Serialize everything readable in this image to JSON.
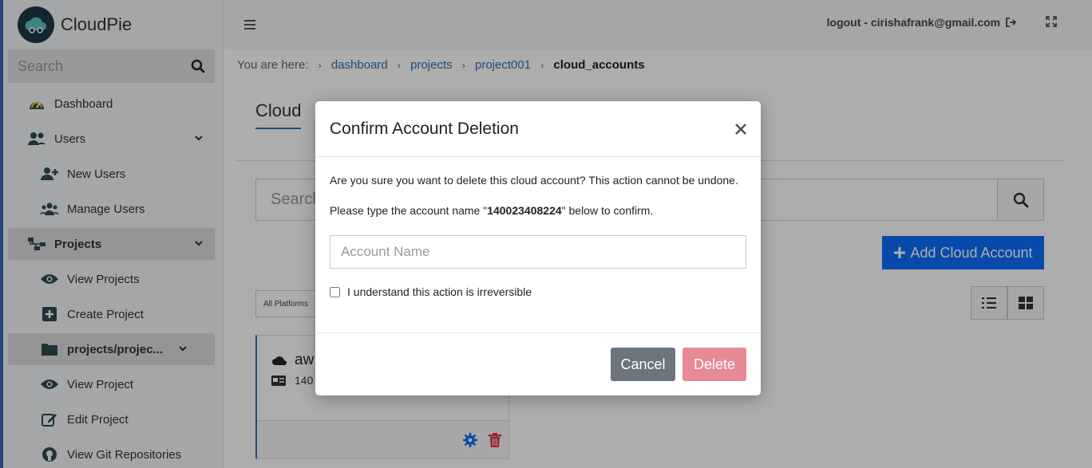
{
  "brand": {
    "name": "CloudPie",
    "logo_icon": "cloud-icon"
  },
  "sidebar": {
    "search_placeholder": "Search",
    "items": [
      {
        "label": "Dashboard",
        "icon": "gauge-icon"
      },
      {
        "label": "Users",
        "icon": "users-icon",
        "expandable": true
      },
      {
        "label": "New Users",
        "icon": "user-plus-icon"
      },
      {
        "label": "Manage Users",
        "icon": "users-cog-icon"
      },
      {
        "label": "Projects",
        "icon": "sitemap-icon",
        "expandable": true
      },
      {
        "label": "View Projects",
        "icon": "eye-icon"
      },
      {
        "label": "Create Project",
        "icon": "plus-square-icon"
      },
      {
        "label": "projects/projec...",
        "icon": "folder-icon",
        "expandable": true
      },
      {
        "label": "View Project",
        "icon": "eye-icon"
      },
      {
        "label": "Edit Project",
        "icon": "edit-icon"
      },
      {
        "label": "View Git Repositories",
        "icon": "github-icon"
      }
    ]
  },
  "topbar": {
    "logout_label": "logout - cirishafrank@gmail.com"
  },
  "breadcrumb": {
    "prefix": "You are here:",
    "items": [
      "dashboard",
      "projects",
      "project001"
    ],
    "current": "cloud_accounts"
  },
  "main": {
    "title": "Cloud",
    "search_placeholder": "Search",
    "add_button_label": "Add Cloud Account",
    "platform_filter": "All Platforms",
    "card": {
      "name": "aw",
      "id": "140"
    }
  },
  "modal": {
    "title": "Confirm Account Deletion",
    "warning": "Are you sure you want to delete this cloud account? This action cannot be undone.",
    "confirm_prefix": "Please type the account name \"",
    "account_name": "140023408224",
    "confirm_suffix": "\" below to confirm.",
    "input_placeholder": "Account Name",
    "checkbox_label": "I understand this action is irreversible",
    "cancel_label": "Cancel",
    "delete_label": "Delete"
  },
  "colors": {
    "accent": "#0d6efd",
    "link": "#2f6fb3",
    "cancel": "#6c757d",
    "delete_disabled": "#e78a95"
  }
}
